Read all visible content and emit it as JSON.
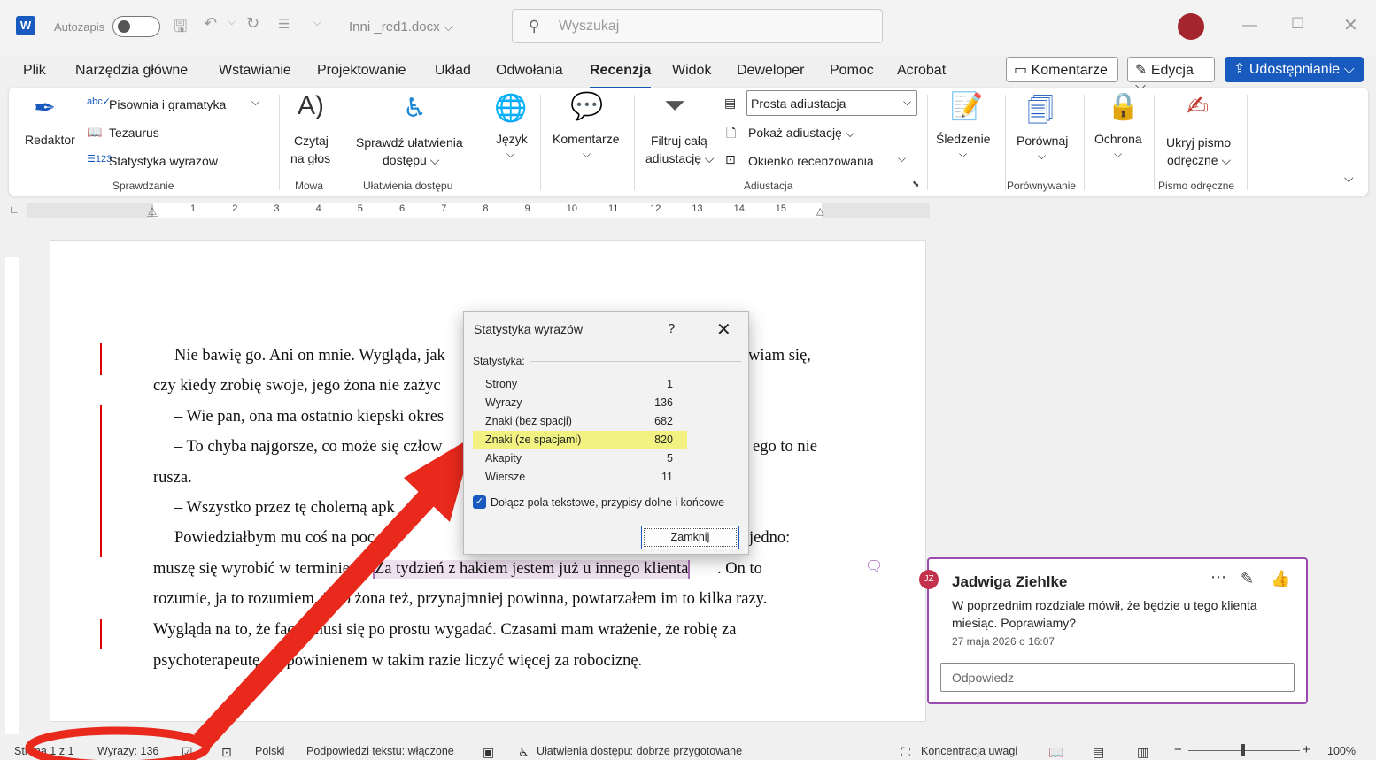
{
  "titlebar": {
    "app_letter": "W",
    "autosave_label": "Autozapis",
    "doc_name": "Inni _red1.docx ⌵",
    "search_placeholder": "Wyszukaj"
  },
  "tabs": [
    "Plik",
    "Narzędzia główne",
    "Wstawianie",
    "Projektowanie",
    "Układ",
    "Odwołania",
    "Recenzja",
    "Widok",
    "Deweloper",
    "Pomoc",
    "Acrobat"
  ],
  "active_tab": "Recenzja",
  "top_buttons": {
    "comments": "Komentarze",
    "editing": "Edycja ⌵",
    "share": "Udostępnianie ⌵"
  },
  "ribbon": {
    "editor": "Redaktor",
    "spelling": "Pisownia i gramatyka",
    "thesaurus": "Tezaurus",
    "word_count": "Statystyka wyrazów",
    "group_proofing": "Sprawdzanie",
    "read_aloud_1": "Czytaj",
    "read_aloud_2": "na głos",
    "group_speech": "Mowa",
    "accessibility_1": "Sprawdź ułatwienia",
    "accessibility_2": "dostępu ⌵",
    "group_accessibility": "Ułatwienia dostępu",
    "language": "Język",
    "comments": "Komentarze",
    "filter_1": "Filtruj całą",
    "filter_2": "adiustację ⌵",
    "markup_select": "Prosta adiustacja",
    "show_markup": "Pokaż adiustację ⌵",
    "review_pane": "Okienko recenzowania",
    "group_tracking": "Adiustacja",
    "track": "Śledzenie",
    "compare": "Porównaj",
    "group_compare": "Porównywanie",
    "protect": "Ochrona",
    "ink_1": "Ukryj pismo",
    "ink_2": "odręczne ⌵",
    "group_ink": "Pismo odręczne"
  },
  "ruler_numbers": [
    "1",
    "2",
    "3",
    "4",
    "5",
    "6",
    "7",
    "8",
    "9",
    "10",
    "11",
    "12",
    "13",
    "14",
    "15"
  ],
  "document": {
    "lines": [
      "Nie bawię go. Ani on mnie. Wygląda, jak",
      "wiam się,",
      "czy kiedy zrobię swoje, jego żona nie zażyc",
      "– Wie pan, ona ma ostatnio kiepski okres",
      "– To chyba najgorsze, co może się człow",
      "ego to nie",
      "rusza.",
      "– Wszystko przez tę cholerną apk",
      "Powiedziałbym mu coś na poc",
      "jedno:",
      "muszę się wyrobić w terminie.",
      "Za tydzień z hakiem jestem już u innego klienta",
      ". On to",
      "rozumie, ja to rozumiem, jego żona też, przynajmniej powinna, powtarzałem im to kilka razy.",
      "Wygląda na to, że facet musi się po prostu wygadać. Czasami mam wrażenie, że robię za",
      "psychoterapeutę, że powinienem w takim razie liczyć więcej za robociznę."
    ]
  },
  "dialog": {
    "title": "Statystyka wyrazów",
    "help": "?",
    "section": "Statystyka:",
    "rows": [
      {
        "label": "Strony",
        "value": "1"
      },
      {
        "label": "Wyrazy",
        "value": "136"
      },
      {
        "label": "Znaki (bez spacji)",
        "value": "682"
      },
      {
        "label": "Znaki (ze spacjami)",
        "value": "820"
      },
      {
        "label": "Akapity",
        "value": "5"
      },
      {
        "label": "Wiersze",
        "value": "11"
      }
    ],
    "checkbox_label": "Dołącz pola tekstowe, przypisy dolne i końcowe",
    "close": "Zamknij"
  },
  "comment": {
    "initials": "JZ",
    "author": "Jadwiga Ziehlke",
    "body": "W poprzednim rozdziale mówił, że będzie u tego klienta miesiąc. Poprawiamy?",
    "date": "27 maja 2026 o 16:07",
    "reply_placeholder": "Odpowiedz"
  },
  "status": {
    "page": "Strona 1 z 1",
    "words": "Wyrazy: 136",
    "language": "Polski",
    "predictions": "Podpowiedzi tekstu: włączone",
    "accessibility": "Ułatwienia dostępu: dobrze przygotowane",
    "focus": "Koncentracja uwagi",
    "zoom": "100%"
  },
  "colors": {
    "accent": "#185abd",
    "highlight": "#f2f283",
    "annotation": "#e8291c",
    "comment_border": "#9a4ab0"
  }
}
